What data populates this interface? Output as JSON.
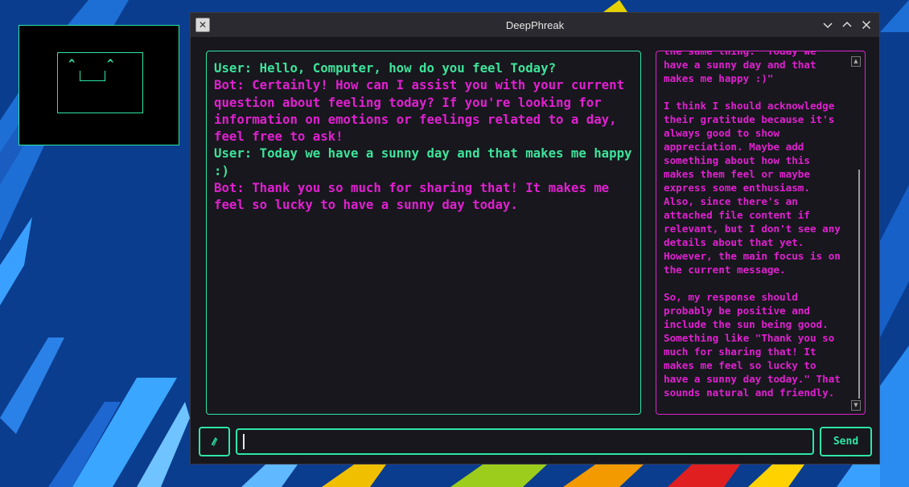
{
  "window": {
    "title": "DeepPhreak",
    "icon": "x-app-icon"
  },
  "face": {
    "left_eye": "^",
    "right_eye": "^"
  },
  "chat": {
    "messages": [
      {
        "role": "user",
        "text": "User: Hello, Computer, how do you feel Today?"
      },
      {
        "role": "bot",
        "text": "Bot: Certainly! How can I assist you with your current question about feeling today? If you're looking for information on emotions or feelings related to a day, feel free to ask!"
      },
      {
        "role": "user",
        "text": "User: Today we have a sunny day and that makes me happy :)"
      },
      {
        "role": "bot",
        "text": "Bot: Thank you so much for sharing that! It makes me feel so lucky to have a sunny day today."
      }
    ]
  },
  "reasoning": {
    "text": "the same thing: \"Today we\nhave a sunny day and that\nmakes me happy :)\"\n\nI think I should acknowledge\ntheir gratitude because it's\nalways good to show\nappreciation. Maybe add\nsomething about how this\nmakes them feel or maybe\nexpress some enthusiasm.\nAlso, since there's an\nattached file content if\nrelevant, but I don't see any\ndetails about that yet.\nHowever, the main focus is on\nthe current message.\n\nSo, my response should\nprobably be positive and\ninclude the sun being good.\nSomething like \"Thank you so\nmuch for sharing that! It\nmakes me feel so lucky to\nhave a sunny day today.\" That\nsounds natural and friendly."
  },
  "input": {
    "value": "",
    "placeholder": ""
  },
  "buttons": {
    "send_label": "Send",
    "attach_icon": "paperclip-icon"
  },
  "colors": {
    "accent_green": "#2ee6a6",
    "user_text": "#3ee39b",
    "bot_text": "#e020d0",
    "window_bg": "#17171d",
    "titlebar_bg": "#2a2a30"
  }
}
